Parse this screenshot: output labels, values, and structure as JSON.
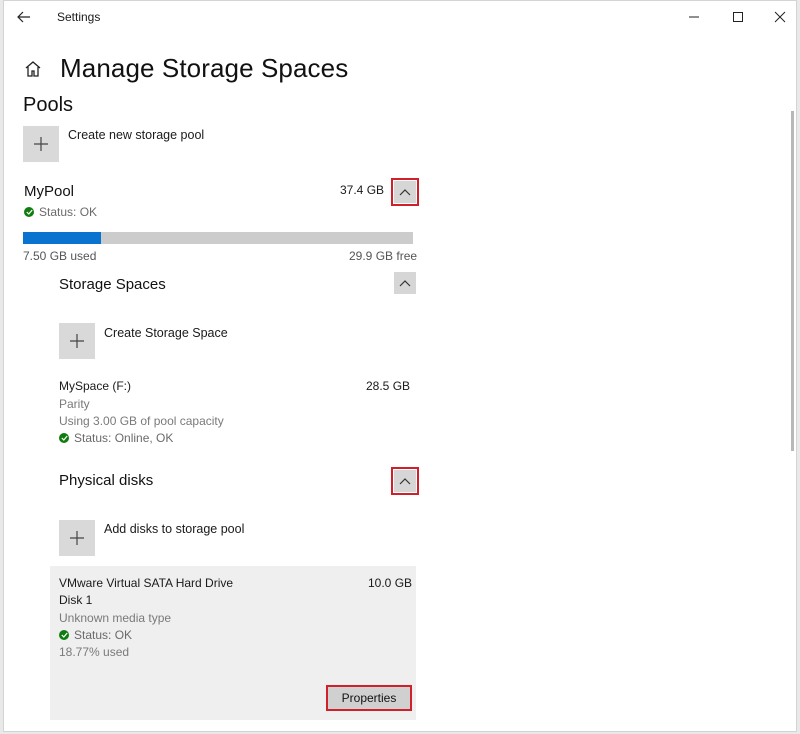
{
  "window": {
    "title": "Settings"
  },
  "page": {
    "title": "Manage Storage Spaces",
    "pools_heading": "Pools"
  },
  "create_pool": {
    "label": "Create new storage pool"
  },
  "pool": {
    "name": "MyPool",
    "size": "37.4 GB",
    "status": "Status: OK",
    "used_label": "7.50 GB used",
    "free_label": "29.9 GB free",
    "used_fraction": 0.2
  },
  "storage_spaces": {
    "heading": "Storage Spaces",
    "create_label": "Create Storage Space",
    "space": {
      "name": "MySpace (F:)",
      "size": "28.5 GB",
      "resiliency": "Parity",
      "usage": "Using 3.00 GB of pool capacity",
      "status": "Status: Online, OK"
    }
  },
  "physical_disks": {
    "heading": "Physical disks",
    "add_label": "Add disks to storage pool",
    "disk": {
      "name": "VMware Virtual SATA Hard Drive",
      "number": "Disk 1",
      "size": "10.0 GB",
      "media": "Unknown media type",
      "status": "Status: OK",
      "used": "18.77% used",
      "properties_label": "Properties"
    }
  },
  "colors": {
    "accent": "#0a73cf",
    "highlight": "#d0202b",
    "ok": "#107c10"
  },
  "icons": [
    "back-arrow-icon",
    "minimize-icon",
    "maximize-icon",
    "close-icon",
    "home-icon",
    "plus-icon",
    "chevron-up-icon",
    "status-ok-icon"
  ]
}
